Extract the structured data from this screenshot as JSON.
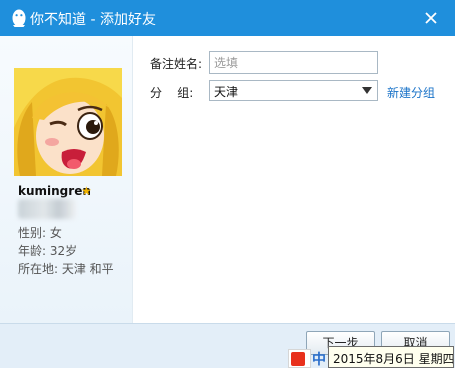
{
  "window": {
    "title": "你不知道 - 添加好友",
    "titlebar_color": "#1f8fdc"
  },
  "profile": {
    "nickname": "kumingren",
    "gender": "性别: 女",
    "age": "年龄: 32岁",
    "location": "所在地: 天津  和平"
  },
  "form": {
    "remark_label": "备注姓名:",
    "remark_placeholder": "选填",
    "group_label": "分    组:",
    "group_value": "天津",
    "new_group_link": "新建分组"
  },
  "buttons": {
    "next": "下一步",
    "cancel": "取消"
  },
  "taskbar": {
    "ime_mode": "中",
    "date_tooltip": "2015年8月6日 星期四"
  },
  "icons": {
    "app": "qq-penguin-icon",
    "close": "close-icon",
    "star": "star-icon",
    "dropdown": "chevron-down-icon",
    "ime": "sogou-icon"
  },
  "colors": {
    "accent": "#1f8fdc",
    "link": "#1a73c8",
    "star": "#f2b400",
    "footer": "#e3eef8"
  }
}
